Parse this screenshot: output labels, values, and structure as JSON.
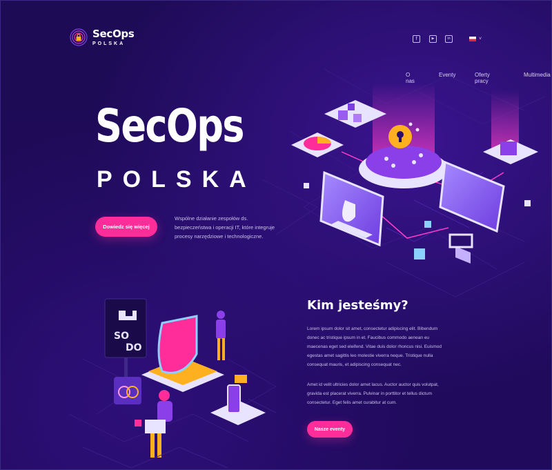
{
  "brand": {
    "name": "SecOps",
    "subtitle": "POLSKA"
  },
  "nav": {
    "items": [
      "O nas",
      "Eventy",
      "Oferty pracy",
      "Multimedia"
    ]
  },
  "social": {
    "facebook": "f",
    "youtube": "▶",
    "linkedin": "in"
  },
  "language": {
    "flag": "pl-flag-icon",
    "chevron": "˅"
  },
  "hero": {
    "title": "SecOps",
    "subtitle": "POLSKA",
    "button": "Dowiedz się więcej",
    "description": "Wspólne działanie zespołów ds. bezpieczeństwa i operacji IT, które integruje procesy narzędziowe i technologiczne."
  },
  "about": {
    "title": "Kim jesteśmy?",
    "paragraph1": "Lorem ipsum dolor sit amet, consectetur adipiscing elit. Bibendum donec ac tristique ipsum in et. Faucibus commodo aenean eu maecenas eget sed eleifend. Vitae duis dolor rhoncus nisi. Euismod egestas amet sagittis leo molestie viverra neque. Tristique nulla consequat mauris, et adipiscing consequat nec.",
    "paragraph2": "Amet id velit ultricies dolor amet lacus. Auctor auctor quis volutpat, gravida est placerat viverra. Pulvinar in porttitor et tellus dictum consectetur. Eget felis amet curabitur at cum.",
    "button": "Nasze eventy"
  },
  "illustration": {
    "sign_top": "SO",
    "sign_bottom": "DO"
  },
  "colors": {
    "background": "#1f0a58",
    "accent": "#ff2d9a",
    "purple": "#7b3fe0",
    "text_muted": "#c9c0ea"
  }
}
